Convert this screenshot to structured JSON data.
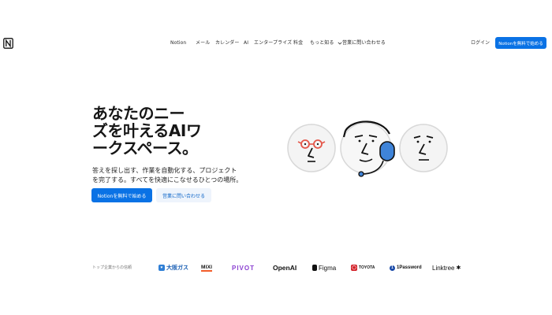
{
  "nav": {
    "items": [
      "Notion",
      "メール",
      "カレンダー",
      "AI",
      "エンタープライズ",
      "料金",
      "もっと知る",
      "営業に問い合わせる"
    ],
    "more_chevron": "chevron-down-icon",
    "login": "ログイン",
    "cta": "Notionを無料で始める"
  },
  "hero": {
    "title": "あなたのニー\nズを叶えるAIワ\nークスペース。",
    "subtitle": "答えを探し出す、作業を自動化する、プロジェクト\nを完了する。すべてを快適にこなせるひとつの場所。",
    "primary_cta": "Notionを無料で始める",
    "secondary_cta": "営業に問い合わせる"
  },
  "trust": {
    "label": "トップ企業からの信頼",
    "brands": [
      "大阪ガス",
      "MIXI",
      "PIVOT",
      "OpenAI",
      "Figma",
      "TOYOTA",
      "1Password",
      "Linktree"
    ]
  },
  "colors": {
    "accent": "#0a72e5",
    "secondary_bg": "#eef4fc",
    "text": "#191919",
    "glasses": "#e4574a"
  }
}
